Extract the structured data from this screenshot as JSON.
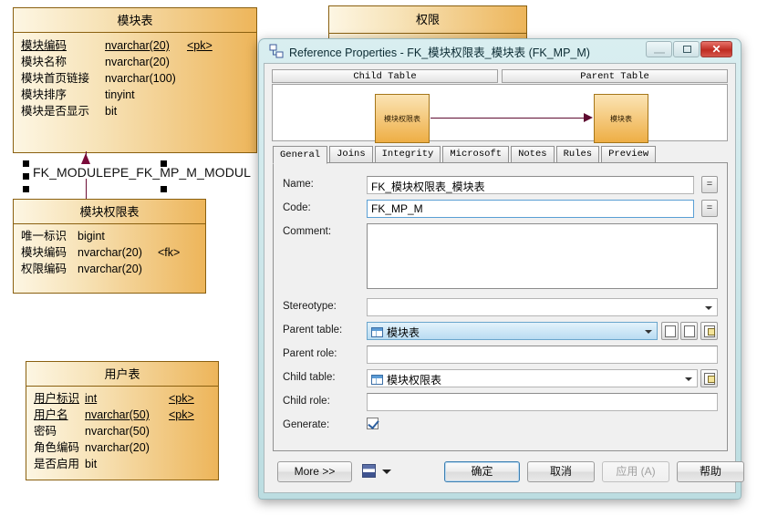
{
  "diagram": {
    "entities": [
      {
        "id": "module",
        "title": "模块表",
        "attributes": [
          {
            "name": "模块编码",
            "type": "nvarchar(20)",
            "key": "<pk>",
            "pk": true
          },
          {
            "name": "模块名称",
            "type": "nvarchar(20)",
            "key": "",
            "pk": false
          },
          {
            "name": "模块首页链接",
            "type": "nvarchar(100)",
            "key": "",
            "pk": false
          },
          {
            "name": "模块排序",
            "type": "tinyint",
            "key": "",
            "pk": false
          },
          {
            "name": "模块是否显示",
            "type": "bit",
            "key": "",
            "pk": false
          }
        ]
      },
      {
        "id": "perm",
        "title": "权限",
        "attributes": []
      },
      {
        "id": "modperm",
        "title": "模块权限表",
        "attributes": [
          {
            "name": "唯一标识",
            "type": "bigint",
            "key": "",
            "pk": false
          },
          {
            "name": "模块编码",
            "type": "nvarchar(20)",
            "key": "<fk>",
            "pk": false
          },
          {
            "name": "权限编码",
            "type": "nvarchar(20)",
            "key": "",
            "pk": false
          }
        ]
      },
      {
        "id": "user",
        "title": "用户表",
        "attributes": [
          {
            "name": "用户标识",
            "type": "int",
            "key": "<pk>",
            "pk": true
          },
          {
            "name": "用户名",
            "type": "nvarchar(50)",
            "key": "<pk>",
            "pk": true
          },
          {
            "name": "密码",
            "type": "nvarchar(50)",
            "key": "",
            "pk": false
          },
          {
            "name": "角色编码",
            "type": "nvarchar(20)",
            "key": "",
            "pk": false
          },
          {
            "name": "是否启用",
            "type": "bit",
            "key": "",
            "pk": false
          }
        ]
      }
    ],
    "relationship_label": "FK_MODULEPE_FK_MP_M_MODUL"
  },
  "dialog": {
    "title": "Reference Properties - FK_模块权限表_模块表 (FK_MP_M)",
    "icon": "reference-icon",
    "window_buttons": {
      "minimize": "minimize-icon",
      "maximize": "maximize-icon",
      "close": "✕"
    },
    "preview": {
      "child_tab": "Child Table",
      "parent_tab": "Parent Table",
      "child_box": "模块权限表",
      "parent_box": "模块表"
    },
    "tabs": [
      {
        "label": "General",
        "active": true
      },
      {
        "label": "Joins",
        "active": false
      },
      {
        "label": "Integrity",
        "active": false
      },
      {
        "label": "Microsoft",
        "active": false
      },
      {
        "label": "Notes",
        "active": false
      },
      {
        "label": "Rules",
        "active": false
      },
      {
        "label": "Preview",
        "active": false
      }
    ],
    "form": {
      "name_label": "Name:",
      "name_value": "FK_模块权限表_模块表",
      "name_equals_button": "=",
      "code_label": "Code:",
      "code_value": "FK_MP_M",
      "code_equals_button": "=",
      "comment_label": "Comment:",
      "comment_value": "",
      "stereotype_label": "Stereotype:",
      "stereotype_value": "",
      "parent_table_label": "Parent table:",
      "parent_table_value": "模块表",
      "parent_role_label": "Parent role:",
      "parent_role_value": "",
      "child_table_label": "Child table:",
      "child_table_value": "模块权限表",
      "child_role_label": "Child role:",
      "child_role_value": "",
      "generate_label": "Generate:",
      "generate_checked": true
    },
    "buttons": {
      "more": "More >>",
      "print": "print-icon",
      "ok": "确定",
      "cancel": "取消",
      "apply": "应用 (A)",
      "help": "帮助"
    }
  }
}
